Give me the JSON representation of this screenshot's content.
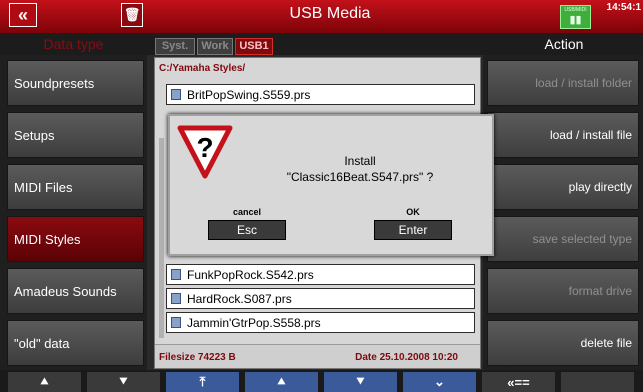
{
  "topbar": {
    "back_label": "«",
    "trash_icon": "trash-icon",
    "title": "USB Media",
    "usb_indicator_label": "USB/MIDI",
    "usb_indicator_icon": "usb-icon",
    "clock": "14:54:1"
  },
  "left_header": "Data type",
  "right_header": "Action",
  "drive_tabs": [
    "Syst.",
    "Work",
    "USB1"
  ],
  "selected_drive_tab": "USB1",
  "data_types": [
    "Soundpresets",
    "Setups",
    "MIDI Files",
    "MIDI Styles",
    "Amadeus Sounds",
    "\"old\" data"
  ],
  "selected_data_type": "MIDI Styles",
  "browser": {
    "path": "C:/Yamaha Styles/",
    "files": [
      "BritPopSwing.S559.prs",
      "FunkPopRock.S542.prs",
      "HardRock.S087.prs",
      "Jammin'GtrPop.S558.prs"
    ],
    "filesize": "Filesize  74223 B",
    "date": "Date  25.10.2008   10:20"
  },
  "actions": [
    "load  /  install folder",
    "load  /  install file",
    "play directly",
    "save  selected  type",
    "format  drive",
    "delete  file"
  ],
  "modal": {
    "title": "Install",
    "filename": "\"Classic16Beat.S547.prs\"  ?",
    "cancel_label": "cancel",
    "ok_label": "OK",
    "esc_button": "Esc",
    "enter_button": "Enter"
  },
  "bottom_bar": [
    "«",
    "»",
    "«",
    "«",
    "»",
    "«",
    "«==",
    ""
  ],
  "bottom_bar_icons": [
    "double-up-icon",
    "double-down-icon",
    "to-top-icon",
    "double-up-icon",
    "double-down-icon",
    "down-icon",
    "back-arrow-icon",
    "blank-icon"
  ],
  "colors": {
    "accent_red": "#c4111a",
    "active_item": "#8a0b10",
    "panel_gray": "#5b5b5b",
    "bottom_blue": "#3a5a9a",
    "usb_green": "#3fae3a"
  }
}
